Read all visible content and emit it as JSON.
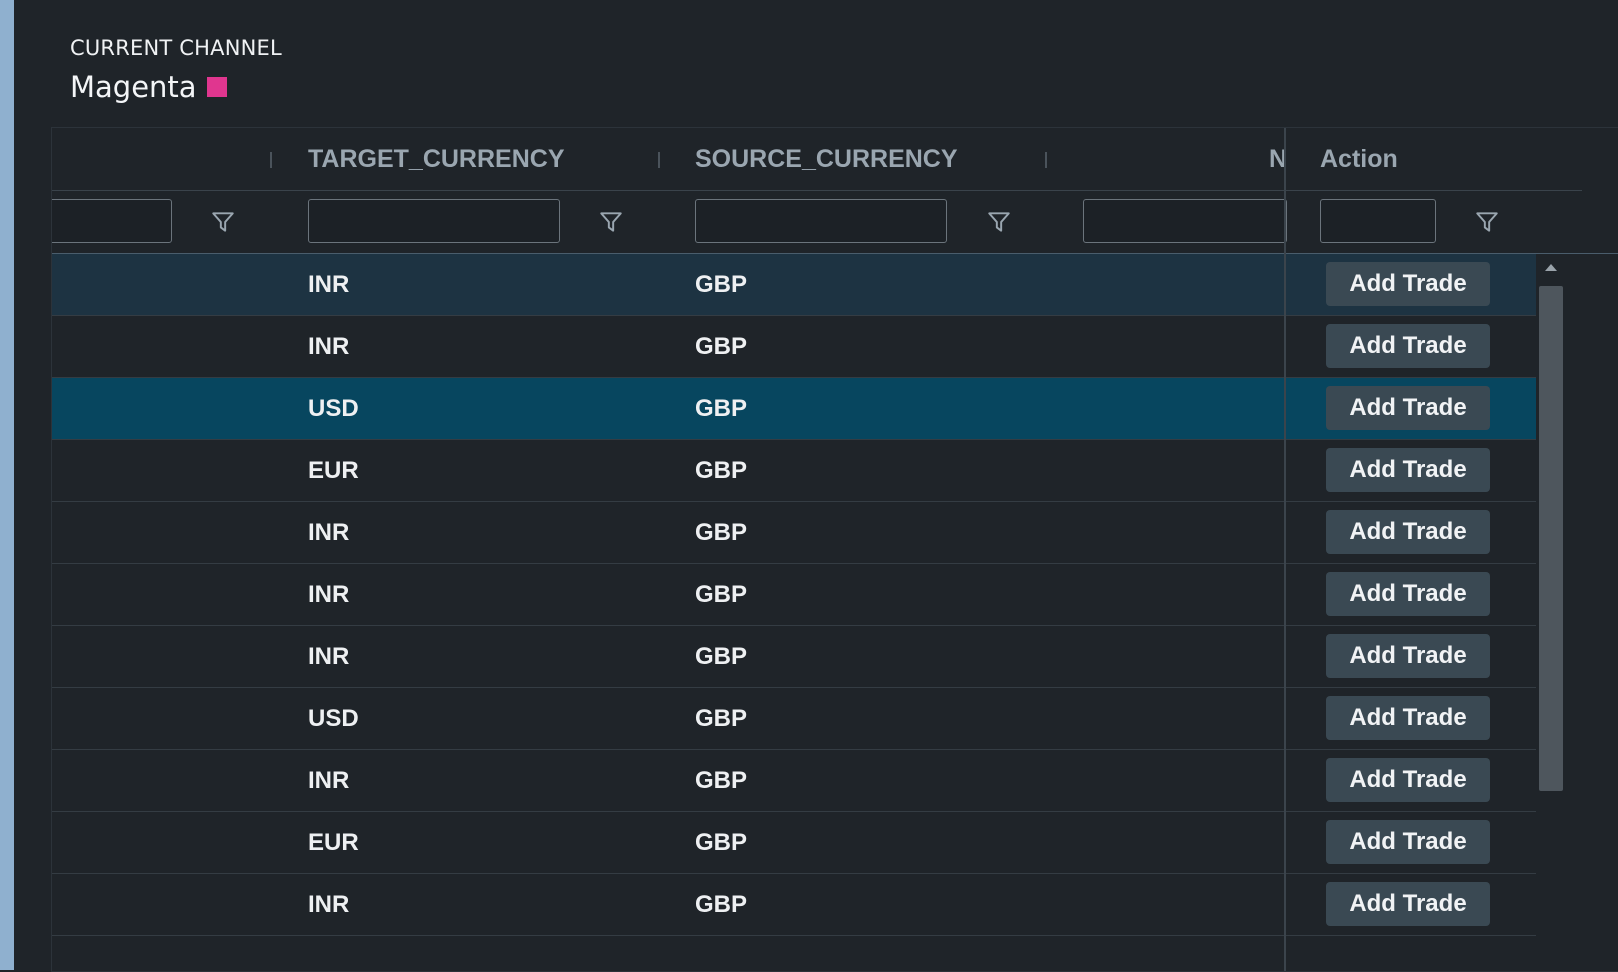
{
  "channel": {
    "label": "CURRENT CHANNEL",
    "name": "Magenta",
    "color": "#e0368f"
  },
  "grid": {
    "columns": [
      {
        "key": "target_currency",
        "header": "TARGET_CURRENCY"
      },
      {
        "key": "source_currency",
        "header": "SOURCE_CURRENCY"
      },
      {
        "key": "partial",
        "header": "N"
      },
      {
        "key": "action",
        "header": "Action"
      }
    ],
    "action_label": "Add Trade",
    "rows": [
      {
        "target": "INR",
        "source": "GBP",
        "state": "hover"
      },
      {
        "target": "INR",
        "source": "GBP",
        "state": "normal"
      },
      {
        "target": "USD",
        "source": "GBP",
        "state": "selected"
      },
      {
        "target": "EUR",
        "source": "GBP",
        "state": "normal"
      },
      {
        "target": "INR",
        "source": "GBP",
        "state": "normal"
      },
      {
        "target": "INR",
        "source": "GBP",
        "state": "normal"
      },
      {
        "target": "INR",
        "source": "GBP",
        "state": "normal"
      },
      {
        "target": "USD",
        "source": "GBP",
        "state": "normal"
      },
      {
        "target": "INR",
        "source": "GBP",
        "state": "normal"
      },
      {
        "target": "EUR",
        "source": "GBP",
        "state": "normal"
      },
      {
        "target": "INR",
        "source": "GBP",
        "state": "normal"
      }
    ]
  },
  "icons": {
    "filter": "filter-icon",
    "scroll_up": "caret-up-icon"
  }
}
